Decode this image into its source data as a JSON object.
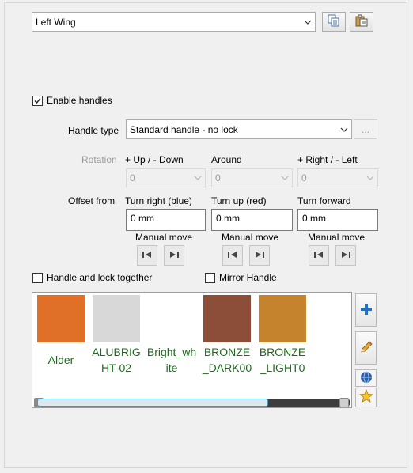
{
  "object_select": {
    "value": "Left Wing"
  },
  "toolbar": {
    "copy_icon": "copy-icon",
    "paste_icon": "paste-icon"
  },
  "enable_handles": {
    "label": "Enable handles",
    "checked": true
  },
  "handle_type": {
    "label": "Handle type",
    "value": "Standard handle - no lock",
    "browse_label": "..."
  },
  "rotation": {
    "label": "Rotation",
    "columns": [
      {
        "header": "+ Up / - Down",
        "value": "0"
      },
      {
        "header": "Around",
        "value": "0"
      },
      {
        "header": "+ Right / - Left",
        "value": "0"
      }
    ]
  },
  "offset": {
    "label": "Offset from",
    "columns": [
      {
        "header": "Turn right (blue)",
        "value": "0 mm",
        "manual_label": "Manual move"
      },
      {
        "header": "Turn up (red)",
        "value": "0 mm",
        "manual_label": "Manual move"
      },
      {
        "header": "Turn forward",
        "value": "0 mm",
        "manual_label": "Manual move"
      }
    ]
  },
  "handle_lock_together": {
    "label": "Handle and lock together",
    "checked": false
  },
  "mirror_handle": {
    "label": "Mirror Handle",
    "checked": false
  },
  "materials": [
    {
      "name": "Alder",
      "color": "#e07028"
    },
    {
      "name": "ALUBRIGHT-02",
      "color": "#d8d8d8"
    },
    {
      "name": "Bright_white",
      "color": "#ffffff"
    },
    {
      "name": "BRONZE_DARK00",
      "color": "#8c4e38"
    },
    {
      "name": "BRONZE_LIGHT0",
      "color": "#c5832d"
    }
  ],
  "gallery_scroll": {
    "position": 0.68
  },
  "side_buttons": [
    "add-icon",
    "pencil-icon",
    "globe-icon",
    "star-icon"
  ],
  "colors": {
    "accent_blue": "#1f6fc5",
    "label_green": "#1d6b1d"
  }
}
